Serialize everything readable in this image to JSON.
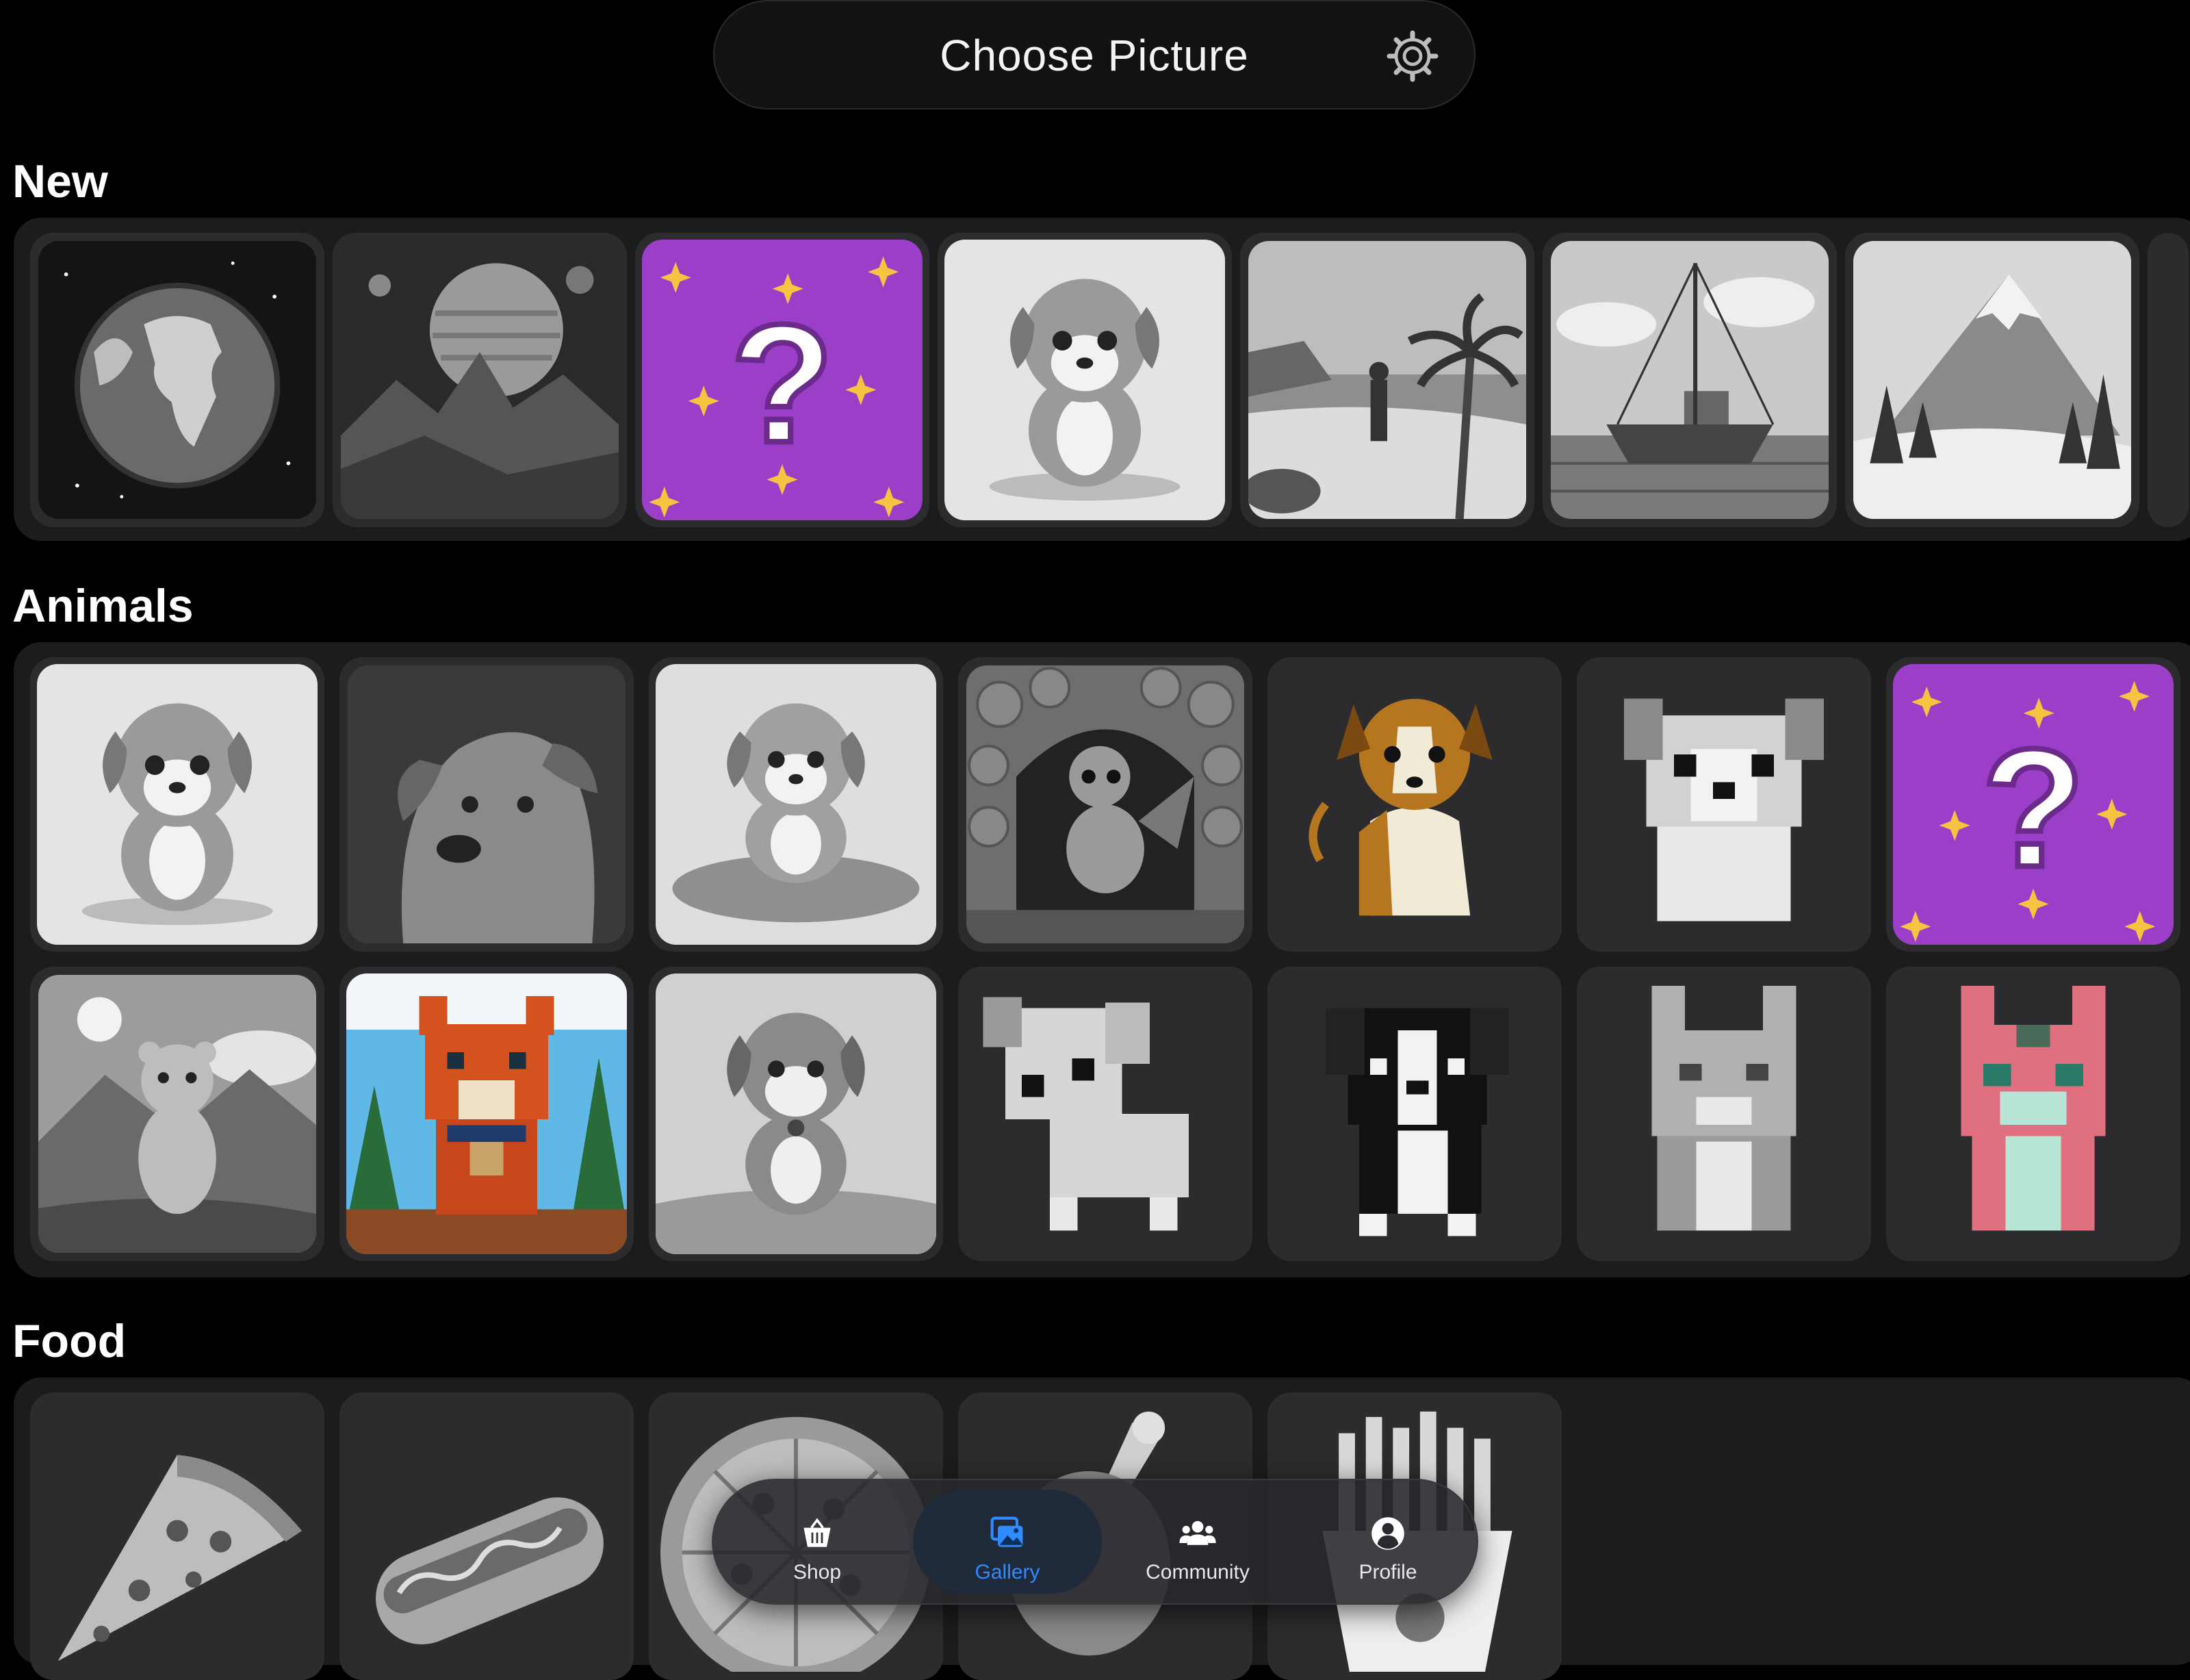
{
  "header": {
    "title": "Choose Picture",
    "settings_icon": "gear-icon"
  },
  "sections": [
    {
      "title": "New",
      "items": [
        {
          "label": "earth",
          "icon": "earth-image"
        },
        {
          "label": "planet landscape",
          "icon": "planet-image"
        },
        {
          "label": "mystery",
          "icon": "question-mark"
        },
        {
          "label": "puppy",
          "icon": "puppy-image"
        },
        {
          "label": "beach",
          "icon": "beach-image"
        },
        {
          "label": "boat",
          "icon": "boat-image"
        },
        {
          "label": "mountain",
          "icon": "mountain-image"
        }
      ]
    },
    {
      "title": "Animals",
      "items": [
        {
          "label": "puppy",
          "icon": "puppy-image"
        },
        {
          "label": "dog portrait",
          "icon": "dog-image"
        },
        {
          "label": "puppy on cushion",
          "icon": "puppy-image"
        },
        {
          "label": "dragon",
          "icon": "dragon-image"
        },
        {
          "label": "brown dog",
          "icon": "dog-image"
        },
        {
          "label": "pixel puppy",
          "icon": "puppy-image"
        },
        {
          "label": "mystery",
          "icon": "question-mark"
        },
        {
          "label": "bear cub",
          "icon": "bear-image"
        },
        {
          "label": "fox",
          "icon": "fox-image"
        },
        {
          "label": "puppy on grass",
          "icon": "puppy-image"
        },
        {
          "label": "pixel puppy",
          "icon": "puppy-image"
        },
        {
          "label": "black and white dog",
          "icon": "dog-image"
        },
        {
          "label": "grey cat",
          "icon": "cat-image"
        },
        {
          "label": "pink cat",
          "icon": "cat-image"
        }
      ]
    },
    {
      "title": "Food",
      "items": [
        {
          "label": "pizza slice",
          "icon": "pizza-image"
        },
        {
          "label": "hot dog",
          "icon": "hotdog-image"
        },
        {
          "label": "pizza",
          "icon": "pizza-image"
        },
        {
          "label": "drumstick",
          "icon": "drumstick-image"
        },
        {
          "label": "fries",
          "icon": "fries-image"
        }
      ]
    }
  ],
  "nav": {
    "items": [
      {
        "label": "Shop",
        "icon": "basket-icon",
        "active": false
      },
      {
        "label": "Gallery",
        "icon": "gallery-icon",
        "active": true
      },
      {
        "label": "Community",
        "icon": "community-icon",
        "active": false
      },
      {
        "label": "Profile",
        "icon": "profile-icon",
        "active": false
      }
    ],
    "active_color": "#2f8bff"
  },
  "colors": {
    "background": "#000000",
    "panel": "#1c1c1e",
    "tile": "#2c2c2e",
    "mystery_purple": "#9b3fc8",
    "star_yellow": "#f5c542"
  }
}
